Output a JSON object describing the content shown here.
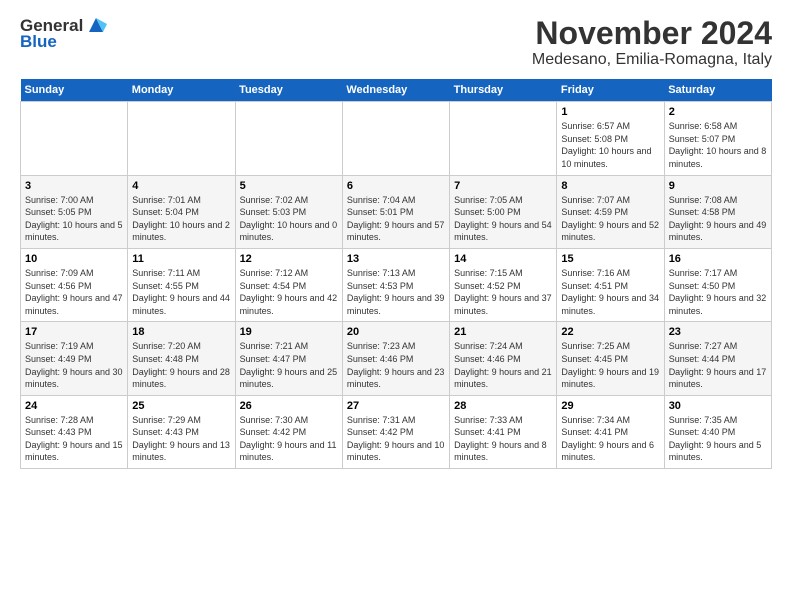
{
  "logo": {
    "general": "General",
    "blue": "Blue"
  },
  "title": "November 2024",
  "location": "Medesano, Emilia-Romagna, Italy",
  "headers": [
    "Sunday",
    "Monday",
    "Tuesday",
    "Wednesday",
    "Thursday",
    "Friday",
    "Saturday"
  ],
  "weeks": [
    [
      {
        "day": "",
        "info": ""
      },
      {
        "day": "",
        "info": ""
      },
      {
        "day": "",
        "info": ""
      },
      {
        "day": "",
        "info": ""
      },
      {
        "day": "",
        "info": ""
      },
      {
        "day": "1",
        "info": "Sunrise: 6:57 AM\nSunset: 5:08 PM\nDaylight: 10 hours and 10 minutes."
      },
      {
        "day": "2",
        "info": "Sunrise: 6:58 AM\nSunset: 5:07 PM\nDaylight: 10 hours and 8 minutes."
      }
    ],
    [
      {
        "day": "3",
        "info": "Sunrise: 7:00 AM\nSunset: 5:05 PM\nDaylight: 10 hours and 5 minutes."
      },
      {
        "day": "4",
        "info": "Sunrise: 7:01 AM\nSunset: 5:04 PM\nDaylight: 10 hours and 2 minutes."
      },
      {
        "day": "5",
        "info": "Sunrise: 7:02 AM\nSunset: 5:03 PM\nDaylight: 10 hours and 0 minutes."
      },
      {
        "day": "6",
        "info": "Sunrise: 7:04 AM\nSunset: 5:01 PM\nDaylight: 9 hours and 57 minutes."
      },
      {
        "day": "7",
        "info": "Sunrise: 7:05 AM\nSunset: 5:00 PM\nDaylight: 9 hours and 54 minutes."
      },
      {
        "day": "8",
        "info": "Sunrise: 7:07 AM\nSunset: 4:59 PM\nDaylight: 9 hours and 52 minutes."
      },
      {
        "day": "9",
        "info": "Sunrise: 7:08 AM\nSunset: 4:58 PM\nDaylight: 9 hours and 49 minutes."
      }
    ],
    [
      {
        "day": "10",
        "info": "Sunrise: 7:09 AM\nSunset: 4:56 PM\nDaylight: 9 hours and 47 minutes."
      },
      {
        "day": "11",
        "info": "Sunrise: 7:11 AM\nSunset: 4:55 PM\nDaylight: 9 hours and 44 minutes."
      },
      {
        "day": "12",
        "info": "Sunrise: 7:12 AM\nSunset: 4:54 PM\nDaylight: 9 hours and 42 minutes."
      },
      {
        "day": "13",
        "info": "Sunrise: 7:13 AM\nSunset: 4:53 PM\nDaylight: 9 hours and 39 minutes."
      },
      {
        "day": "14",
        "info": "Sunrise: 7:15 AM\nSunset: 4:52 PM\nDaylight: 9 hours and 37 minutes."
      },
      {
        "day": "15",
        "info": "Sunrise: 7:16 AM\nSunset: 4:51 PM\nDaylight: 9 hours and 34 minutes."
      },
      {
        "day": "16",
        "info": "Sunrise: 7:17 AM\nSunset: 4:50 PM\nDaylight: 9 hours and 32 minutes."
      }
    ],
    [
      {
        "day": "17",
        "info": "Sunrise: 7:19 AM\nSunset: 4:49 PM\nDaylight: 9 hours and 30 minutes."
      },
      {
        "day": "18",
        "info": "Sunrise: 7:20 AM\nSunset: 4:48 PM\nDaylight: 9 hours and 28 minutes."
      },
      {
        "day": "19",
        "info": "Sunrise: 7:21 AM\nSunset: 4:47 PM\nDaylight: 9 hours and 25 minutes."
      },
      {
        "day": "20",
        "info": "Sunrise: 7:23 AM\nSunset: 4:46 PM\nDaylight: 9 hours and 23 minutes."
      },
      {
        "day": "21",
        "info": "Sunrise: 7:24 AM\nSunset: 4:46 PM\nDaylight: 9 hours and 21 minutes."
      },
      {
        "day": "22",
        "info": "Sunrise: 7:25 AM\nSunset: 4:45 PM\nDaylight: 9 hours and 19 minutes."
      },
      {
        "day": "23",
        "info": "Sunrise: 7:27 AM\nSunset: 4:44 PM\nDaylight: 9 hours and 17 minutes."
      }
    ],
    [
      {
        "day": "24",
        "info": "Sunrise: 7:28 AM\nSunset: 4:43 PM\nDaylight: 9 hours and 15 minutes."
      },
      {
        "day": "25",
        "info": "Sunrise: 7:29 AM\nSunset: 4:43 PM\nDaylight: 9 hours and 13 minutes."
      },
      {
        "day": "26",
        "info": "Sunrise: 7:30 AM\nSunset: 4:42 PM\nDaylight: 9 hours and 11 minutes."
      },
      {
        "day": "27",
        "info": "Sunrise: 7:31 AM\nSunset: 4:42 PM\nDaylight: 9 hours and 10 minutes."
      },
      {
        "day": "28",
        "info": "Sunrise: 7:33 AM\nSunset: 4:41 PM\nDaylight: 9 hours and 8 minutes."
      },
      {
        "day": "29",
        "info": "Sunrise: 7:34 AM\nSunset: 4:41 PM\nDaylight: 9 hours and 6 minutes."
      },
      {
        "day": "30",
        "info": "Sunrise: 7:35 AM\nSunset: 4:40 PM\nDaylight: 9 hours and 5 minutes."
      }
    ]
  ]
}
